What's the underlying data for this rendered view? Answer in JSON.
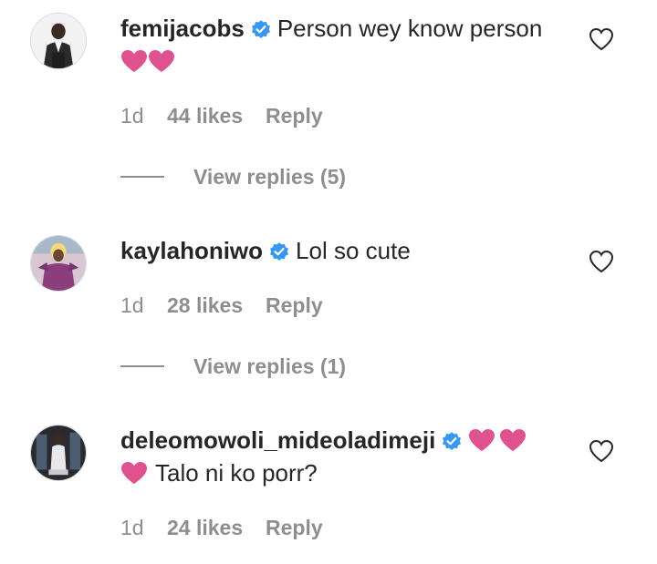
{
  "comments": [
    {
      "username": "femijacobs",
      "verified": true,
      "text": "Person wey know person",
      "time": "1d",
      "likes": "44 likes",
      "reply_label": "Reply",
      "view_replies": "View replies (5)"
    },
    {
      "username": "kaylahoniwo",
      "verified": true,
      "text": "Lol so cute",
      "time": "1d",
      "likes": "28 likes",
      "reply_label": "Reply",
      "view_replies": "View replies (1)"
    },
    {
      "username": "deleomowoli_mideoladimeji",
      "verified": true,
      "text": "Talo ni ko porr?",
      "time": "1d",
      "likes": "24 likes",
      "reply_label": "Reply"
    }
  ],
  "icons": {
    "verified": "verified-badge-icon",
    "heart_emoji": "pink-heart-emoji",
    "like": "heart-outline-icon"
  },
  "colors": {
    "text": "#262626",
    "secondary": "#8e8e8e",
    "verified": "#3897f0",
    "heart_emoji": "#e0528f"
  }
}
